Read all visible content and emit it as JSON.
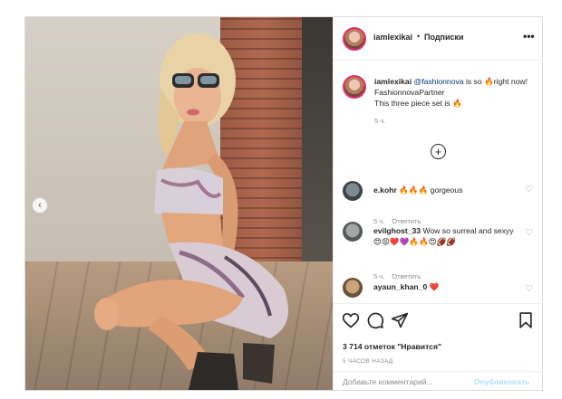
{
  "post": {
    "username": "iamlexikai",
    "follow_label": "Подписки",
    "separator": "•",
    "more_glyph": "•••",
    "prev_glyph": "‹"
  },
  "caption": {
    "username": "iamlexikai",
    "mention": "@fashionnova",
    "text_after_mention": " is so 🔥right now! FashionnovaPartner",
    "line2": "This three piece set is 🔥",
    "time": "5 ч."
  },
  "load_more_glyph": "+",
  "comments": [
    {
      "username": "e.kohr",
      "text": " 🔥🔥🔥 gorgeous",
      "time": "5 ч.",
      "reply": "Ответить"
    },
    {
      "username": "evilghost_33",
      "text": " Wow so surreal and sexyy😍😡❤️💜🔥🔥😍🏈🏈",
      "time": "5 ч.",
      "reply": "Ответить"
    },
    {
      "username": "ayaun_khan_0",
      "text": " ❤️",
      "time": "",
      "reply": ""
    }
  ],
  "actions": {
    "likes": "3 714 отметок \"Нравится\"",
    "date": "5 ЧАСОВ НАЗАД",
    "comment_placeholder": "Добавьте комментарий...",
    "post_label": "Опубликовать"
  },
  "colors": {
    "accent_blue": "#0095f6",
    "post_disabled": "#b2dffc",
    "muted": "#8e8e8e",
    "text": "#262626"
  },
  "icons": [
    "more-icon",
    "prev-arrow-icon",
    "load-more-icon",
    "heart-icon",
    "comment-icon",
    "share-icon",
    "bookmark-icon"
  ]
}
